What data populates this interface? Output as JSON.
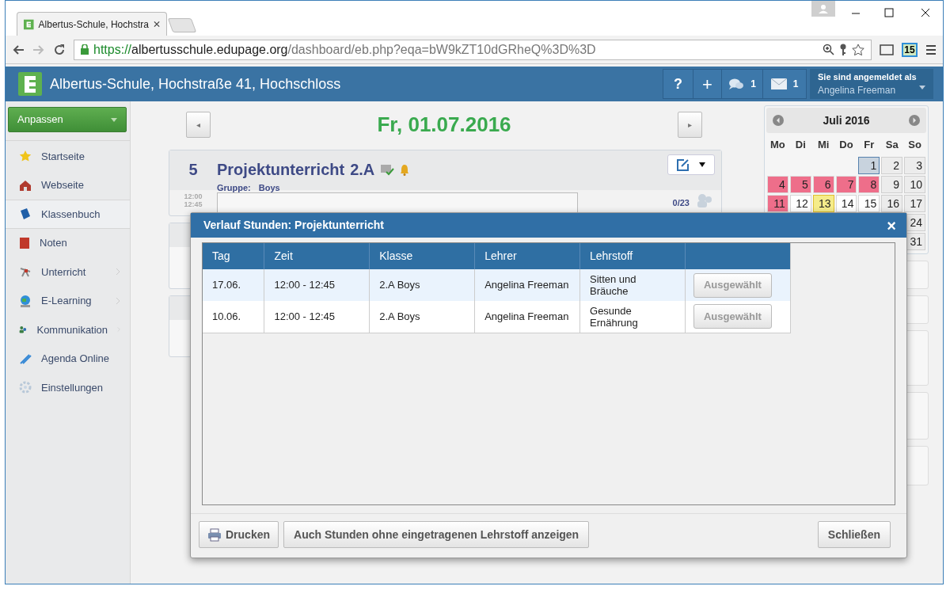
{
  "browser": {
    "tab_title": "Albertus-Schule, Hochstra",
    "url_scheme": "https://",
    "url_host": "albertusschule.edupage.org",
    "url_path": "/dashboard/eb.php?eqa=bW9kZT10dGRheQ%3D%3D",
    "badge": "15"
  },
  "header": {
    "school": "Albertus-Schule, Hochstraße 41, Hochschloss",
    "help": "?",
    "add": "+",
    "messages_count": "1",
    "mail_count": "1",
    "login_label": "Sie sind angemeldet als",
    "user": "Angelina Freeman"
  },
  "sidebar": {
    "customize": "Anpassen",
    "items": [
      {
        "label": "Startseite",
        "selected": false,
        "submenu": false
      },
      {
        "label": "Webseite",
        "selected": false,
        "submenu": false
      },
      {
        "label": "Klassenbuch",
        "selected": true,
        "submenu": false
      },
      {
        "label": "Noten",
        "selected": false,
        "submenu": false
      },
      {
        "label": "Unterricht",
        "selected": false,
        "submenu": true
      },
      {
        "label": "E-Learning",
        "selected": false,
        "submenu": true
      },
      {
        "label": "Kommunikation",
        "selected": false,
        "submenu": true
      },
      {
        "label": "Agenda Online",
        "selected": false,
        "submenu": false
      },
      {
        "label": "Einstellungen",
        "selected": false,
        "submenu": false
      }
    ]
  },
  "day": {
    "prev": "◂",
    "next": "▸",
    "date": "Fr, 01.07.2016"
  },
  "lesson": {
    "number": "5",
    "title": "Projektunterricht",
    "class": "2.A",
    "group_label": "Gruppe:",
    "group": "Boys",
    "start": "12:00",
    "end": "12:45",
    "count": "0/23"
  },
  "calendar": {
    "month": "Juli 2016",
    "weekdays": [
      "Mo",
      "Di",
      "Mi",
      "Do",
      "Fr",
      "Sa",
      "So"
    ],
    "weeks": [
      [
        {
          "kind": "blank"
        },
        {
          "kind": "blank"
        },
        {
          "kind": "blank"
        },
        {
          "kind": "blank"
        },
        {
          "kind": "selected",
          "day": "1"
        },
        {
          "kind": "weekend",
          "day": "2"
        },
        {
          "kind": "weekend",
          "day": "3"
        }
      ],
      [
        {
          "kind": "holiday",
          "day": "4"
        },
        {
          "kind": "holiday",
          "day": "5"
        },
        {
          "kind": "holiday",
          "day": "6"
        },
        {
          "kind": "holiday",
          "day": "7"
        },
        {
          "kind": "holiday",
          "day": "8"
        },
        {
          "kind": "weekend",
          "day": "9"
        },
        {
          "kind": "weekend",
          "day": "10"
        }
      ],
      [
        {
          "kind": "holiday",
          "day": "11"
        },
        {
          "kind": "normal",
          "day": "12"
        },
        {
          "kind": "today",
          "day": "13"
        },
        {
          "kind": "normal",
          "day": "14"
        },
        {
          "kind": "normal",
          "day": "15"
        },
        {
          "kind": "weekend",
          "day": "16"
        },
        {
          "kind": "weekend",
          "day": "17"
        }
      ],
      [
        {
          "kind": "blank"
        },
        {
          "kind": "blank"
        },
        {
          "kind": "blank"
        },
        {
          "kind": "blank"
        },
        {
          "kind": "blank"
        },
        {
          "kind": "blank"
        },
        {
          "kind": "weekend",
          "day": "24"
        }
      ],
      [
        {
          "kind": "blank"
        },
        {
          "kind": "blank"
        },
        {
          "kind": "blank"
        },
        {
          "kind": "blank"
        },
        {
          "kind": "blank"
        },
        {
          "kind": "blank"
        },
        {
          "kind": "weekend",
          "day": "31"
        }
      ]
    ]
  },
  "dialog": {
    "title": "Verlauf Stunden: Projektunterricht",
    "close": "×",
    "columns": [
      "Tag",
      "Zeit",
      "Klasse",
      "Lehrer",
      "Lehrstoff"
    ],
    "rows": [
      {
        "day": "17.06.",
        "time": "12:00 - 12:45",
        "class": "2.A Boys",
        "teacher": "Angelina Freeman",
        "topic": "Sitten und Bräuche",
        "action": "Ausgewählt",
        "selected": true
      },
      {
        "day": "10.06.",
        "time": "12:00 - 12:45",
        "class": "2.A Boys",
        "teacher": "Angelina Freeman",
        "topic": "Gesunde Ernährung",
        "action": "Ausgewählt",
        "selected": false
      }
    ],
    "print": "Drucken",
    "show_all": "Auch Stunden ohne eingetragenen Lehrstoff anzeigen",
    "close_button": "Schließen"
  }
}
